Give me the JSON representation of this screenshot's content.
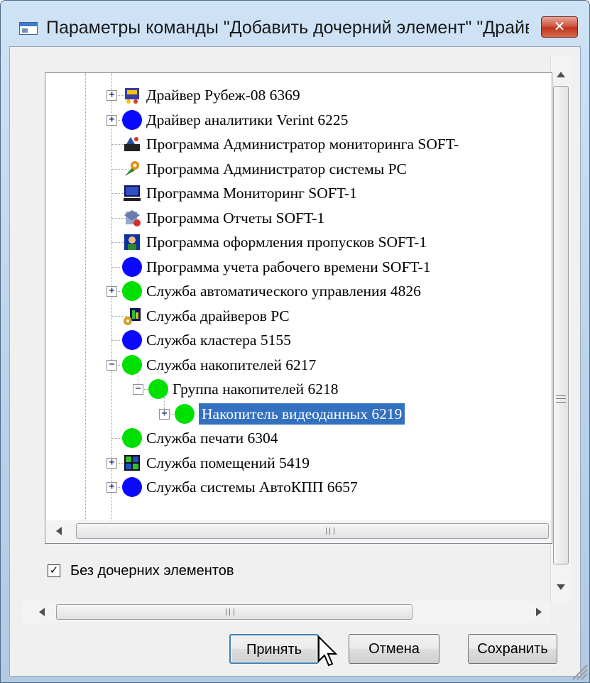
{
  "window": {
    "title": "Параметры команды \"Добавить дочерний элемент\" \"Драйв...",
    "close_glyph": "✕"
  },
  "tree": {
    "items": [
      {
        "label": "Драйвер Рубеж-08 6369",
        "level": 0,
        "expander": "+",
        "icon": "rubezh-driver-icon"
      },
      {
        "label": "Драйвер аналитики Verint 6225",
        "level": 0,
        "expander": "+",
        "icon": "blue-circle-icon",
        "color": "#0a0aff"
      },
      {
        "label": "Программа Администратор мониторинга SOFT-",
        "level": 0,
        "expander": "",
        "icon": "monitoring-admin-icon"
      },
      {
        "label": "Программа Администратор системы PC",
        "level": 0,
        "expander": "",
        "icon": "system-admin-icon"
      },
      {
        "label": "Программа Мониторинг SOFT-1",
        "level": 0,
        "expander": "",
        "icon": "monitor-computer-icon"
      },
      {
        "label": "Программа Отчеты SOFT-1",
        "level": 0,
        "expander": "",
        "icon": "reports-icon"
      },
      {
        "label": "Программа оформления пропусков SOFT-1",
        "level": 0,
        "expander": "",
        "icon": "pass-office-icon"
      },
      {
        "label": "Программа учета рабочего времени SOFT-1",
        "level": 0,
        "expander": "",
        "icon": "blue-circle-icon",
        "color": "#0a0aff"
      },
      {
        "label": "Служба автоматического управления 4826",
        "level": 0,
        "expander": "+",
        "icon": "green-circle-icon",
        "color": "#00e000"
      },
      {
        "label": "Служба драйверов PC",
        "level": 0,
        "expander": "",
        "icon": "driver-service-icon"
      },
      {
        "label": "Служба кластера 5155",
        "level": 0,
        "expander": "",
        "icon": "blue-circle-icon",
        "color": "#0a0aff"
      },
      {
        "label": "Служба накопителей 6217",
        "level": 0,
        "expander": "−",
        "icon": "green-circle-icon",
        "color": "#00e000"
      },
      {
        "label": "Группа накопителей 6218",
        "level": 1,
        "expander": "−",
        "icon": "green-circle-icon",
        "color": "#00e000"
      },
      {
        "label": "Накопитель видеоданных 6219",
        "level": 2,
        "expander": "+",
        "icon": "green-circle-icon",
        "color": "#00e000",
        "selected": true
      },
      {
        "label": "Служба печати 6304",
        "level": 0,
        "expander": "",
        "icon": "green-circle-icon",
        "color": "#00e000"
      },
      {
        "label": "Служба помещений 5419",
        "level": 0,
        "expander": "+",
        "icon": "rooms-service-icon"
      },
      {
        "label": "Служба системы АвтоКПП 6657",
        "level": 0,
        "expander": "+",
        "icon": "blue-circle-icon",
        "color": "#0a0aff"
      }
    ],
    "scrollbar_grip": "III"
  },
  "options": {
    "no_children_label": "Без дочерних элементов",
    "no_children_checked": true,
    "check_glyph": "✓"
  },
  "buttons": {
    "accept_label": "Принять",
    "cancel_label": "Отмена",
    "save_label": "Сохранить"
  },
  "colors": {
    "selection": "#3470c0",
    "blue_status": "#0a0aff",
    "green_status": "#00e000"
  }
}
